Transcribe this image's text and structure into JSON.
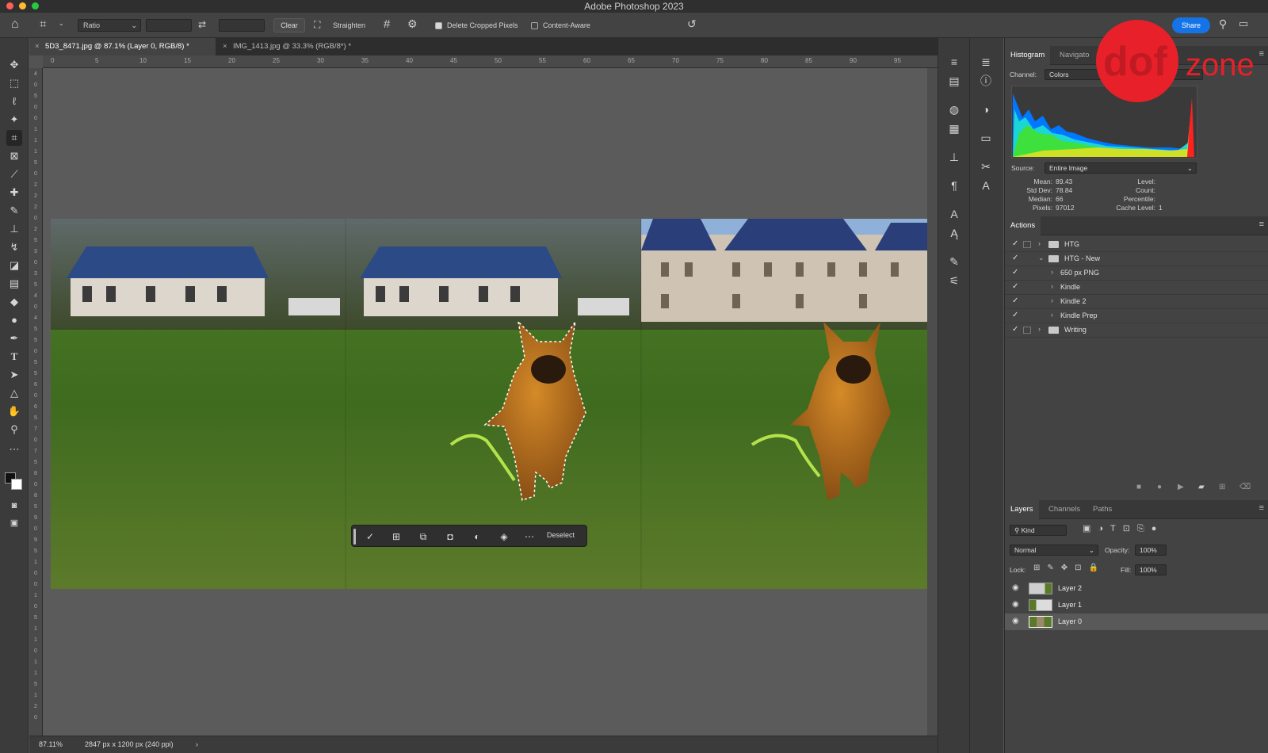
{
  "app": {
    "title": "Adobe Photoshop 2023"
  },
  "options": {
    "ratio": "Ratio",
    "clear": "Clear",
    "straighten": "Straighten",
    "delete_cropped": "Delete Cropped Pixels",
    "content_aware": "Content-Aware",
    "share": "Share"
  },
  "tabs": [
    {
      "label": "5D3_8471.jpg @ 87.1% (Layer 0, RGB/8) *"
    },
    {
      "label": "IMG_1413.jpg @ 33.3% (RGB/8*) *"
    }
  ],
  "ruler": {
    "top": [
      "0",
      "5",
      "10",
      "15",
      "20",
      "25",
      "30",
      "35",
      "40",
      "45",
      "50",
      "55",
      "60",
      "65",
      "70",
      "75",
      "80",
      "85",
      "90",
      "95",
      "10"
    ],
    "left": [
      "4",
      "0",
      "5",
      "0",
      "0",
      "1",
      "1",
      "1",
      "5",
      "0",
      "2",
      "2",
      "2",
      "0",
      "2",
      "5",
      "3",
      "0",
      "3",
      "5",
      "4",
      "0",
      "4",
      "5",
      "5",
      "0",
      "5",
      "5",
      "6",
      "0",
      "6",
      "5",
      "7",
      "0",
      "7",
      "5",
      "8",
      "0",
      "8",
      "5",
      "9",
      "0",
      "9",
      "5",
      "1",
      "0",
      "0",
      "1",
      "0",
      "5",
      "1",
      "1",
      "0",
      "1",
      "1",
      "5",
      "1",
      "2",
      "0"
    ]
  },
  "taskbar": {
    "deselect": "Deselect"
  },
  "status": {
    "zoom": "87.11%",
    "info": "2847 px x 1200 px (240 ppi)"
  },
  "histogram": {
    "tabs": [
      "Histogram",
      "Navigato"
    ],
    "channel_label": "Channel:",
    "channel": "Colors",
    "source_label": "Source:",
    "source": "Entire Image",
    "stats_left": [
      {
        "k": "Mean:",
        "v": "89.43"
      },
      {
        "k": "Std Dev:",
        "v": "78.84"
      },
      {
        "k": "Median:",
        "v": "66"
      },
      {
        "k": "Pixels:",
        "v": "97012"
      }
    ],
    "stats_right": [
      {
        "k": "Level:",
        "v": ""
      },
      {
        "k": "Count:",
        "v": ""
      },
      {
        "k": "Percentile:",
        "v": ""
      },
      {
        "k": "Cache Level:",
        "v": "1"
      }
    ]
  },
  "watermark": {
    "a": "dof",
    "b": "zone"
  },
  "actions": {
    "title": "Actions",
    "items": [
      {
        "name": "HTG",
        "level": 0,
        "open": false
      },
      {
        "name": "HTG - New",
        "level": 0,
        "open": true
      },
      {
        "name": "650 px PNG",
        "level": 1
      },
      {
        "name": "Kindle",
        "level": 1
      },
      {
        "name": "Kindle 2",
        "level": 1
      },
      {
        "name": "Kindle Prep",
        "level": 1
      },
      {
        "name": "Writing",
        "level": 0,
        "open": false
      }
    ]
  },
  "layers": {
    "tabs": [
      "Layers",
      "Channels",
      "Paths"
    ],
    "kind": "Kind",
    "blend": "Normal",
    "opacity_label": "Opacity:",
    "opacity": "100%",
    "lock_label": "Lock:",
    "fill_label": "Fill:",
    "fill": "100%",
    "items": [
      {
        "name": "Layer 2",
        "selected": false
      },
      {
        "name": "Layer 1",
        "selected": false
      },
      {
        "name": "Layer 0",
        "selected": true
      }
    ]
  },
  "colors": {
    "accent": "#1473e6",
    "watermark_red": "#e8202a"
  }
}
